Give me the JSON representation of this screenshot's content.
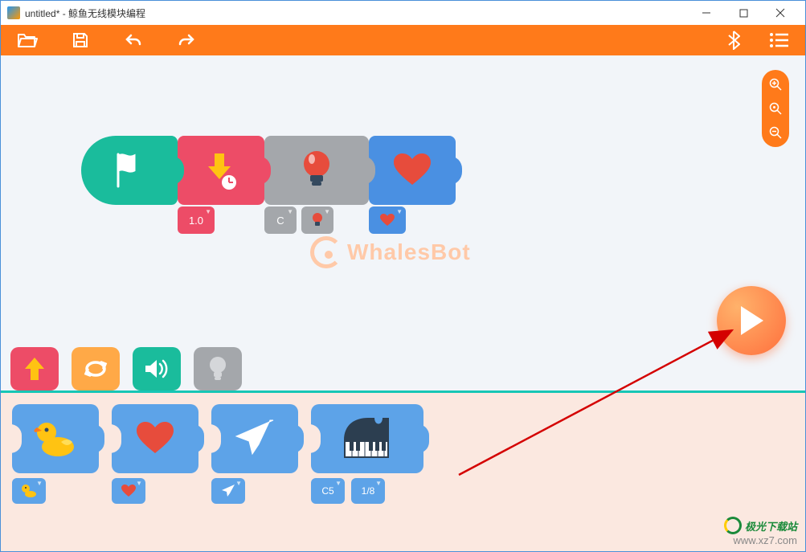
{
  "window": {
    "title": "untitled*  -  鲸鱼无线模块编程"
  },
  "toolbar": {
    "open_icon": "folder-open",
    "save_icon": "save",
    "undo_icon": "undo",
    "redo_icon": "redo",
    "bluetooth_icon": "bluetooth",
    "menu_icon": "list-menu"
  },
  "zoom": {
    "in": "zoom-in",
    "reset": "zoom-reset",
    "out": "zoom-out"
  },
  "watermark": "WhalesBot",
  "program": {
    "blocks": [
      {
        "type": "start",
        "icon": "flag"
      },
      {
        "type": "download",
        "icon": "download-clock",
        "params": [
          {
            "value": "1.0"
          }
        ]
      },
      {
        "type": "bulb",
        "icon": "bulb-red",
        "params": [
          {
            "value": "C"
          },
          {
            "icon": "bulb-red-small"
          }
        ]
      },
      {
        "type": "heart",
        "icon": "heart-red",
        "params": [
          {
            "icon": "heart-red-small"
          }
        ]
      }
    ]
  },
  "categories": [
    {
      "id": "upload",
      "color": "pink",
      "icon": "arrow-up"
    },
    {
      "id": "loop",
      "color": "orange",
      "icon": "repeat"
    },
    {
      "id": "sound",
      "color": "teal",
      "icon": "volume",
      "active": true
    },
    {
      "id": "light",
      "color": "gray",
      "icon": "bulb"
    }
  ],
  "palette": [
    {
      "id": "duck",
      "icon": "duck",
      "params": [
        {
          "icon": "duck-small"
        }
      ]
    },
    {
      "id": "heart",
      "icon": "heart",
      "params": [
        {
          "icon": "heart-small"
        }
      ]
    },
    {
      "id": "plane",
      "icon": "plane",
      "params": [
        {
          "icon": "plane-small"
        }
      ]
    },
    {
      "id": "piano",
      "icon": "piano",
      "wide": true,
      "params": [
        {
          "value": "C5"
        },
        {
          "value": "1/8"
        }
      ]
    }
  ],
  "play_button": "play",
  "site_watermark": {
    "name": "极光下载站",
    "url": "www.xz7.com"
  }
}
